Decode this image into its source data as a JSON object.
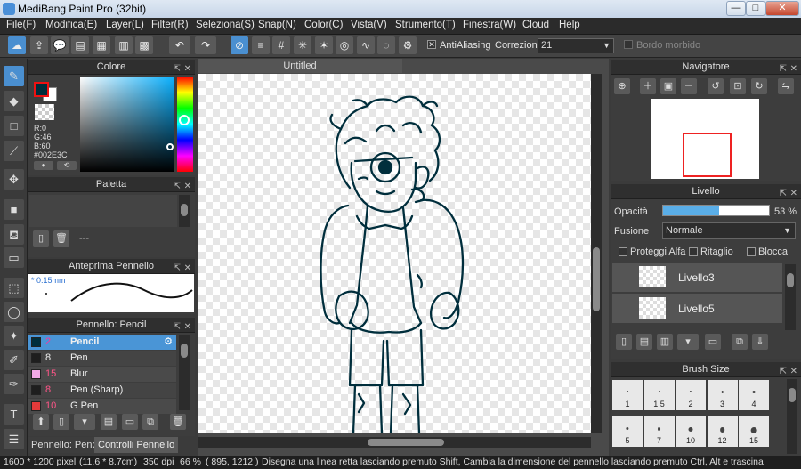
{
  "window": {
    "title": "MediBang Paint Pro (32bit)",
    "min": "—",
    "max": "□",
    "close": "✕"
  },
  "menu": [
    "File(F)",
    "Modifica(E)",
    "Layer(L)",
    "Filter(R)",
    "Seleziona(S)",
    "Snap(N)",
    "Color(C)",
    "Vista(V)",
    "Strumento(T)",
    "Finestra(W)",
    "Cloud",
    "Help"
  ],
  "toolbar": {
    "antialiasing_label": "AntiAliasing",
    "antialiasing_checked": "✕",
    "correzione_label": "Correzione",
    "correzione_value": "21",
    "bordo_label": "Bordo morbido"
  },
  "colore": {
    "title": "Colore",
    "r": "R:0",
    "g": "G:46",
    "b": "B:60",
    "hex": "#002E3C",
    "fg": "#002e3c",
    "bg": "#ffffff"
  },
  "paletta": {
    "title": "Paletta",
    "dash": "---"
  },
  "anteprima": {
    "title": "Anteprima Pennello",
    "size": "0.15mm"
  },
  "pennello": {
    "title": "Pennello: Pencil",
    "brushes": [
      {
        "size": "2",
        "name": "Pencil",
        "color": "#002e3c",
        "selected": true
      },
      {
        "size": "8",
        "name": "Pen",
        "color": "#1e1e1e"
      },
      {
        "size": "15",
        "name": "Blur",
        "color": "#f2a9e6"
      },
      {
        "size": "8",
        "name": "Pen (Sharp)",
        "color": "#1e1e1e"
      },
      {
        "size": "10",
        "name": "G Pen",
        "color": "#e23a3a"
      }
    ]
  },
  "tabs": {
    "pennello": "Pennello: Pencil",
    "controlli": "Controlli Pennello"
  },
  "document": {
    "title": "Untitled"
  },
  "navigatore": {
    "title": "Navigatore"
  },
  "livello": {
    "title": "Livello",
    "opacita_label": "Opacità",
    "opacita_value": "53 %",
    "opacity_fraction": 0.53,
    "fusione_label": "Fusione",
    "fusione_value": "Normale",
    "proteggi": "Proteggi Alfa",
    "ritaglio": "Ritaglio",
    "blocca": "Blocca",
    "layers": [
      "Livello3",
      "Livello5"
    ]
  },
  "brush_size": {
    "title": "Brush Size",
    "sizes": [
      "1",
      "1.5",
      "2",
      "3",
      "4",
      "5",
      "7",
      "10",
      "12",
      "15"
    ]
  },
  "status": {
    "size": "1600 * 1200 pixel",
    "cm": "(11.6 * 8.7cm)",
    "dpi": "350 dpi",
    "zoom": "66 %",
    "coords": "( 895, 1212 )",
    "hint": "Disegna una linea retta lasciando premuto Shift, Cambia la dimensione del pennello lasciando premuto Ctrl, Alt e trascina"
  }
}
